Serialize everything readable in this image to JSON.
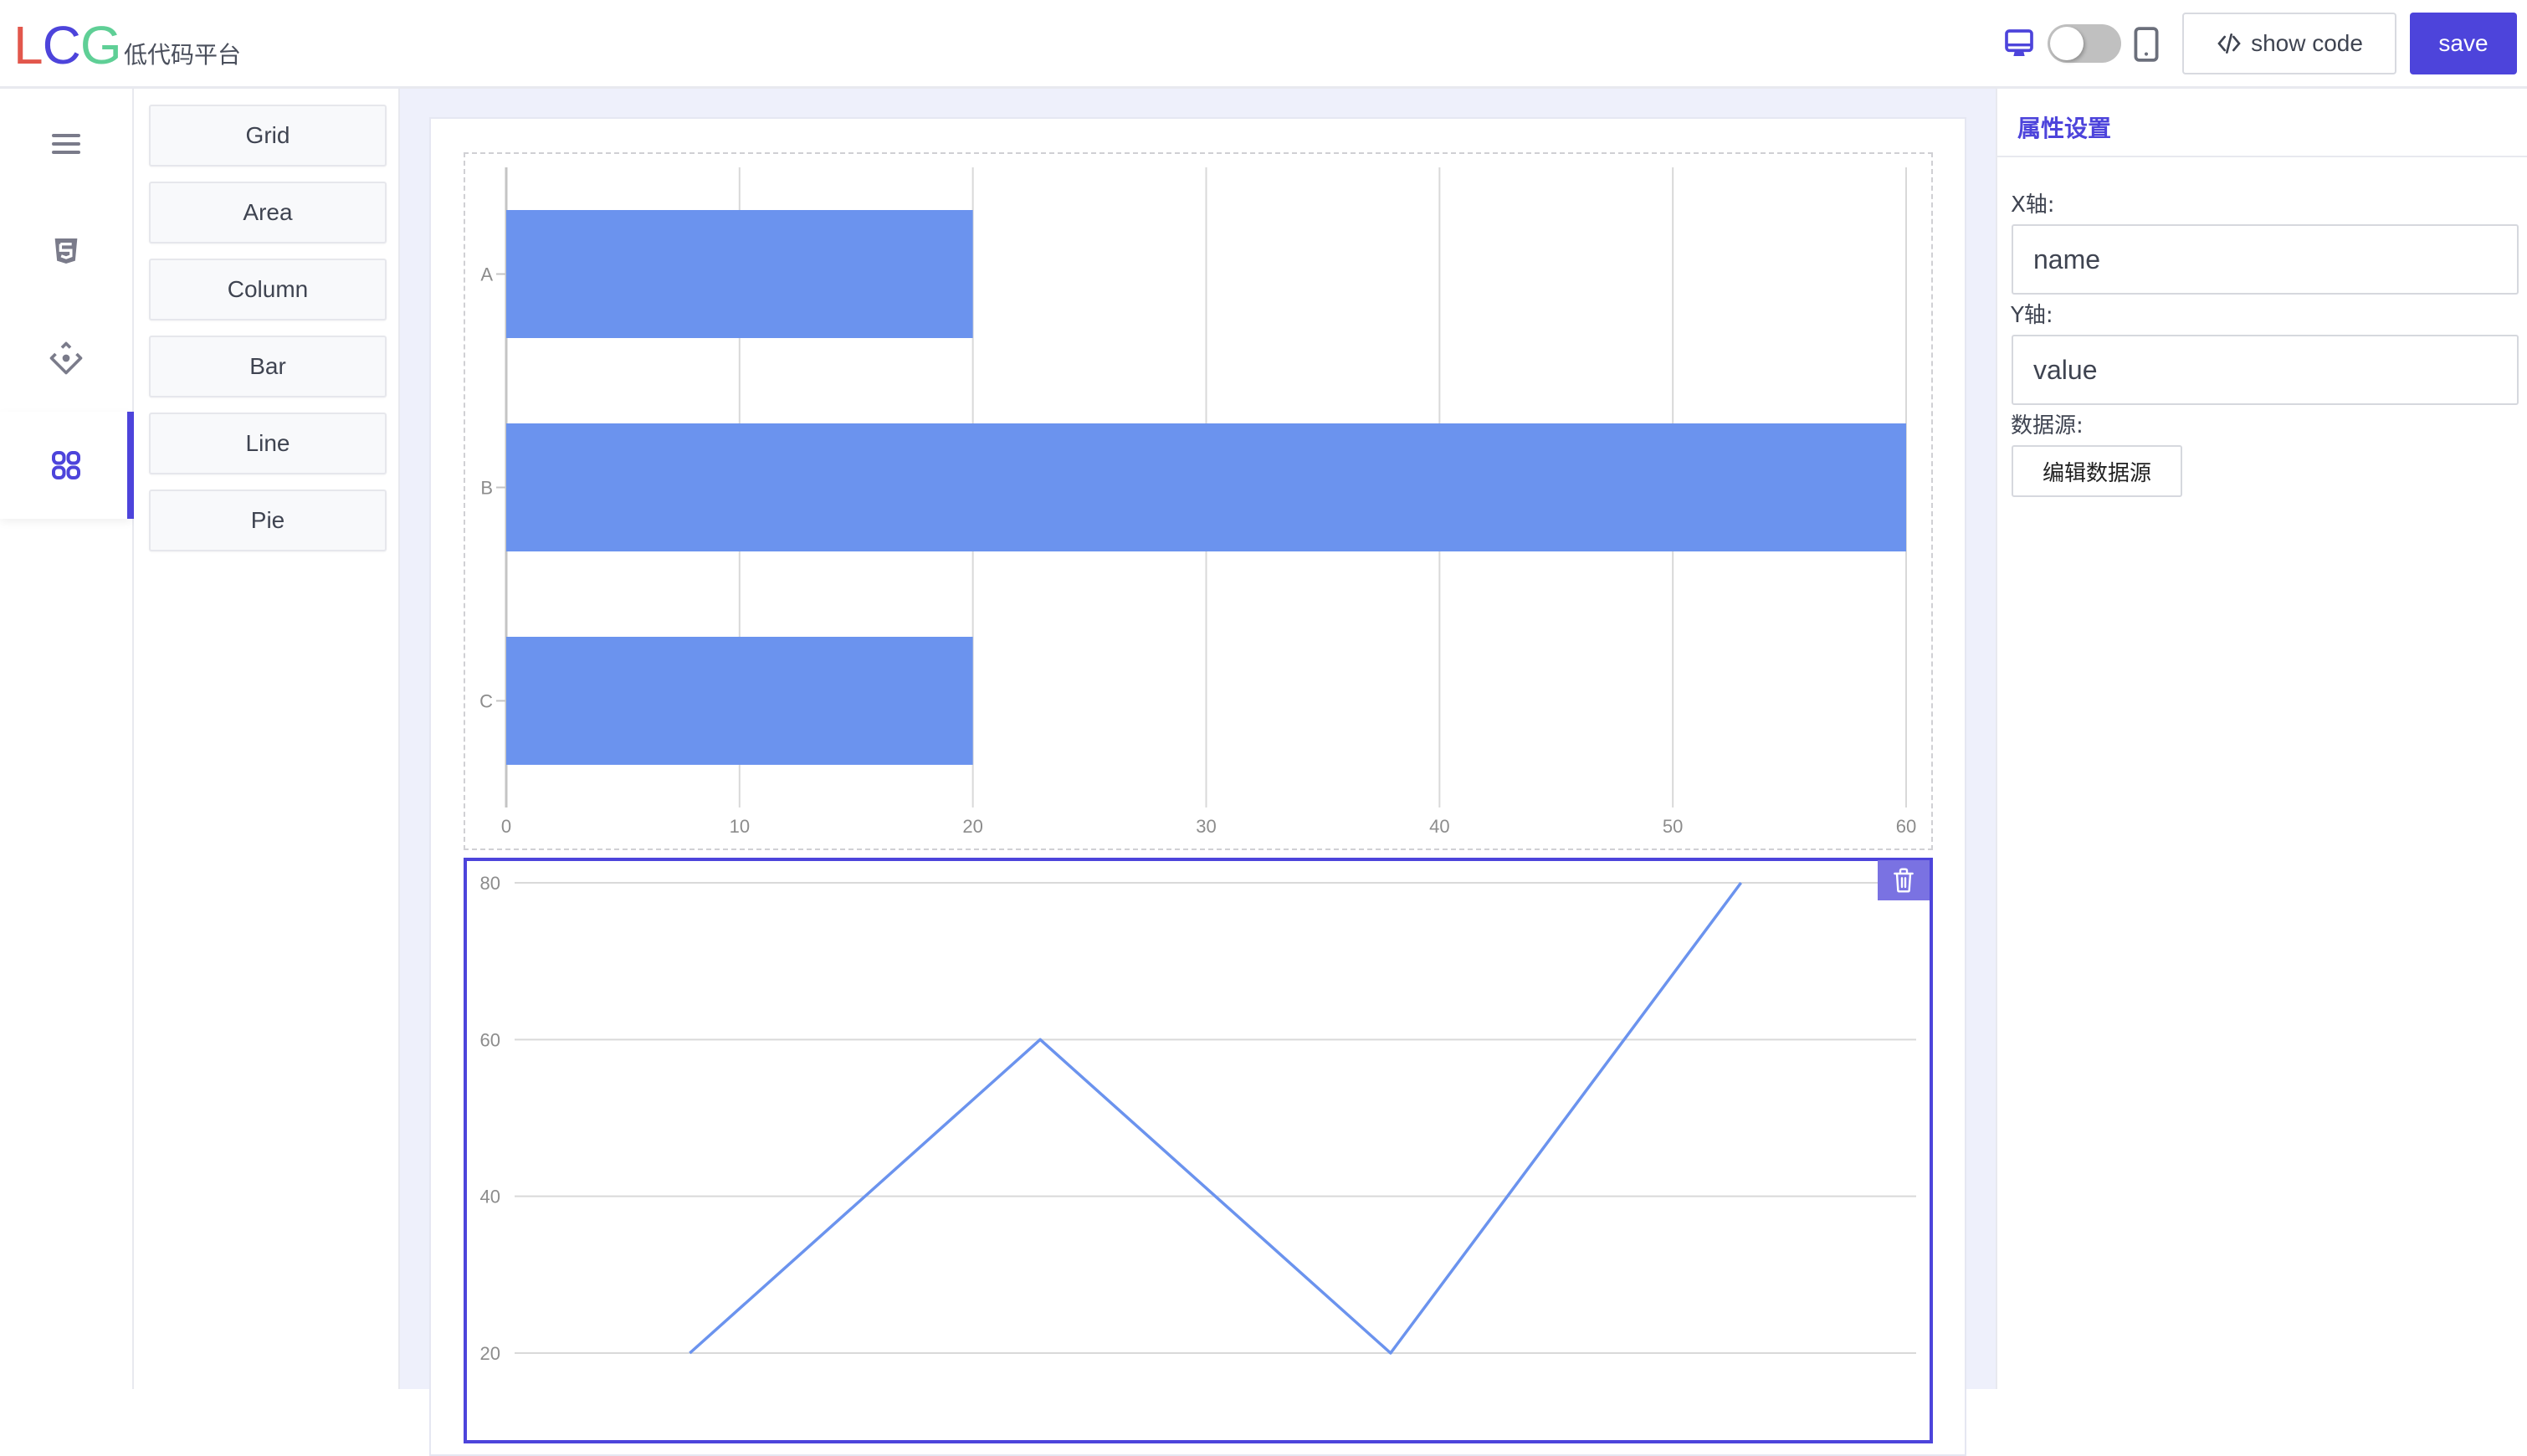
{
  "header": {
    "logo": {
      "l": "L",
      "c": "C",
      "g": "G"
    },
    "subtitle": "低代码平台",
    "show_code_label": "show code",
    "save_label": "save",
    "device_toggle": {
      "selected": "desktop"
    }
  },
  "rail": {
    "items": [
      {
        "icon": "menu-icon"
      },
      {
        "icon": "html5-icon"
      },
      {
        "icon": "component-icon"
      },
      {
        "icon": "apps-grid-icon",
        "active": true
      }
    ]
  },
  "components": {
    "items": [
      {
        "label": "Grid"
      },
      {
        "label": "Area"
      },
      {
        "label": "Column"
      },
      {
        "label": "Bar"
      },
      {
        "label": "Line"
      },
      {
        "label": "Pie"
      }
    ]
  },
  "props": {
    "title": "属性设置",
    "x_label": "X轴:",
    "x_value": "name",
    "y_label": "Y轴:",
    "y_value": "value",
    "source_label": "数据源:",
    "edit_source_label": "编辑数据源"
  },
  "colors": {
    "accent": "#4d44db",
    "series": "#6b93ee",
    "grid": "#d9d9d9"
  },
  "chart_data": [
    {
      "type": "bar",
      "orientation": "horizontal",
      "categories": [
        "A",
        "B",
        "C"
      ],
      "values": [
        20,
        60,
        20
      ],
      "xlim": [
        0,
        60
      ],
      "xticks": [
        "0",
        "10",
        "20",
        "30",
        "40",
        "50",
        "60"
      ],
      "title": "",
      "xlabel": "",
      "ylabel": "",
      "grid": true
    },
    {
      "type": "line",
      "categories": [
        "",
        "",
        "",
        ""
      ],
      "values": [
        20,
        60,
        20,
        80
      ],
      "ylim": [
        20,
        80
      ],
      "yticks": [
        "20",
        "40",
        "60",
        "80"
      ],
      "title": "",
      "xlabel": "",
      "ylabel": "",
      "grid": true,
      "selected": true
    }
  ]
}
